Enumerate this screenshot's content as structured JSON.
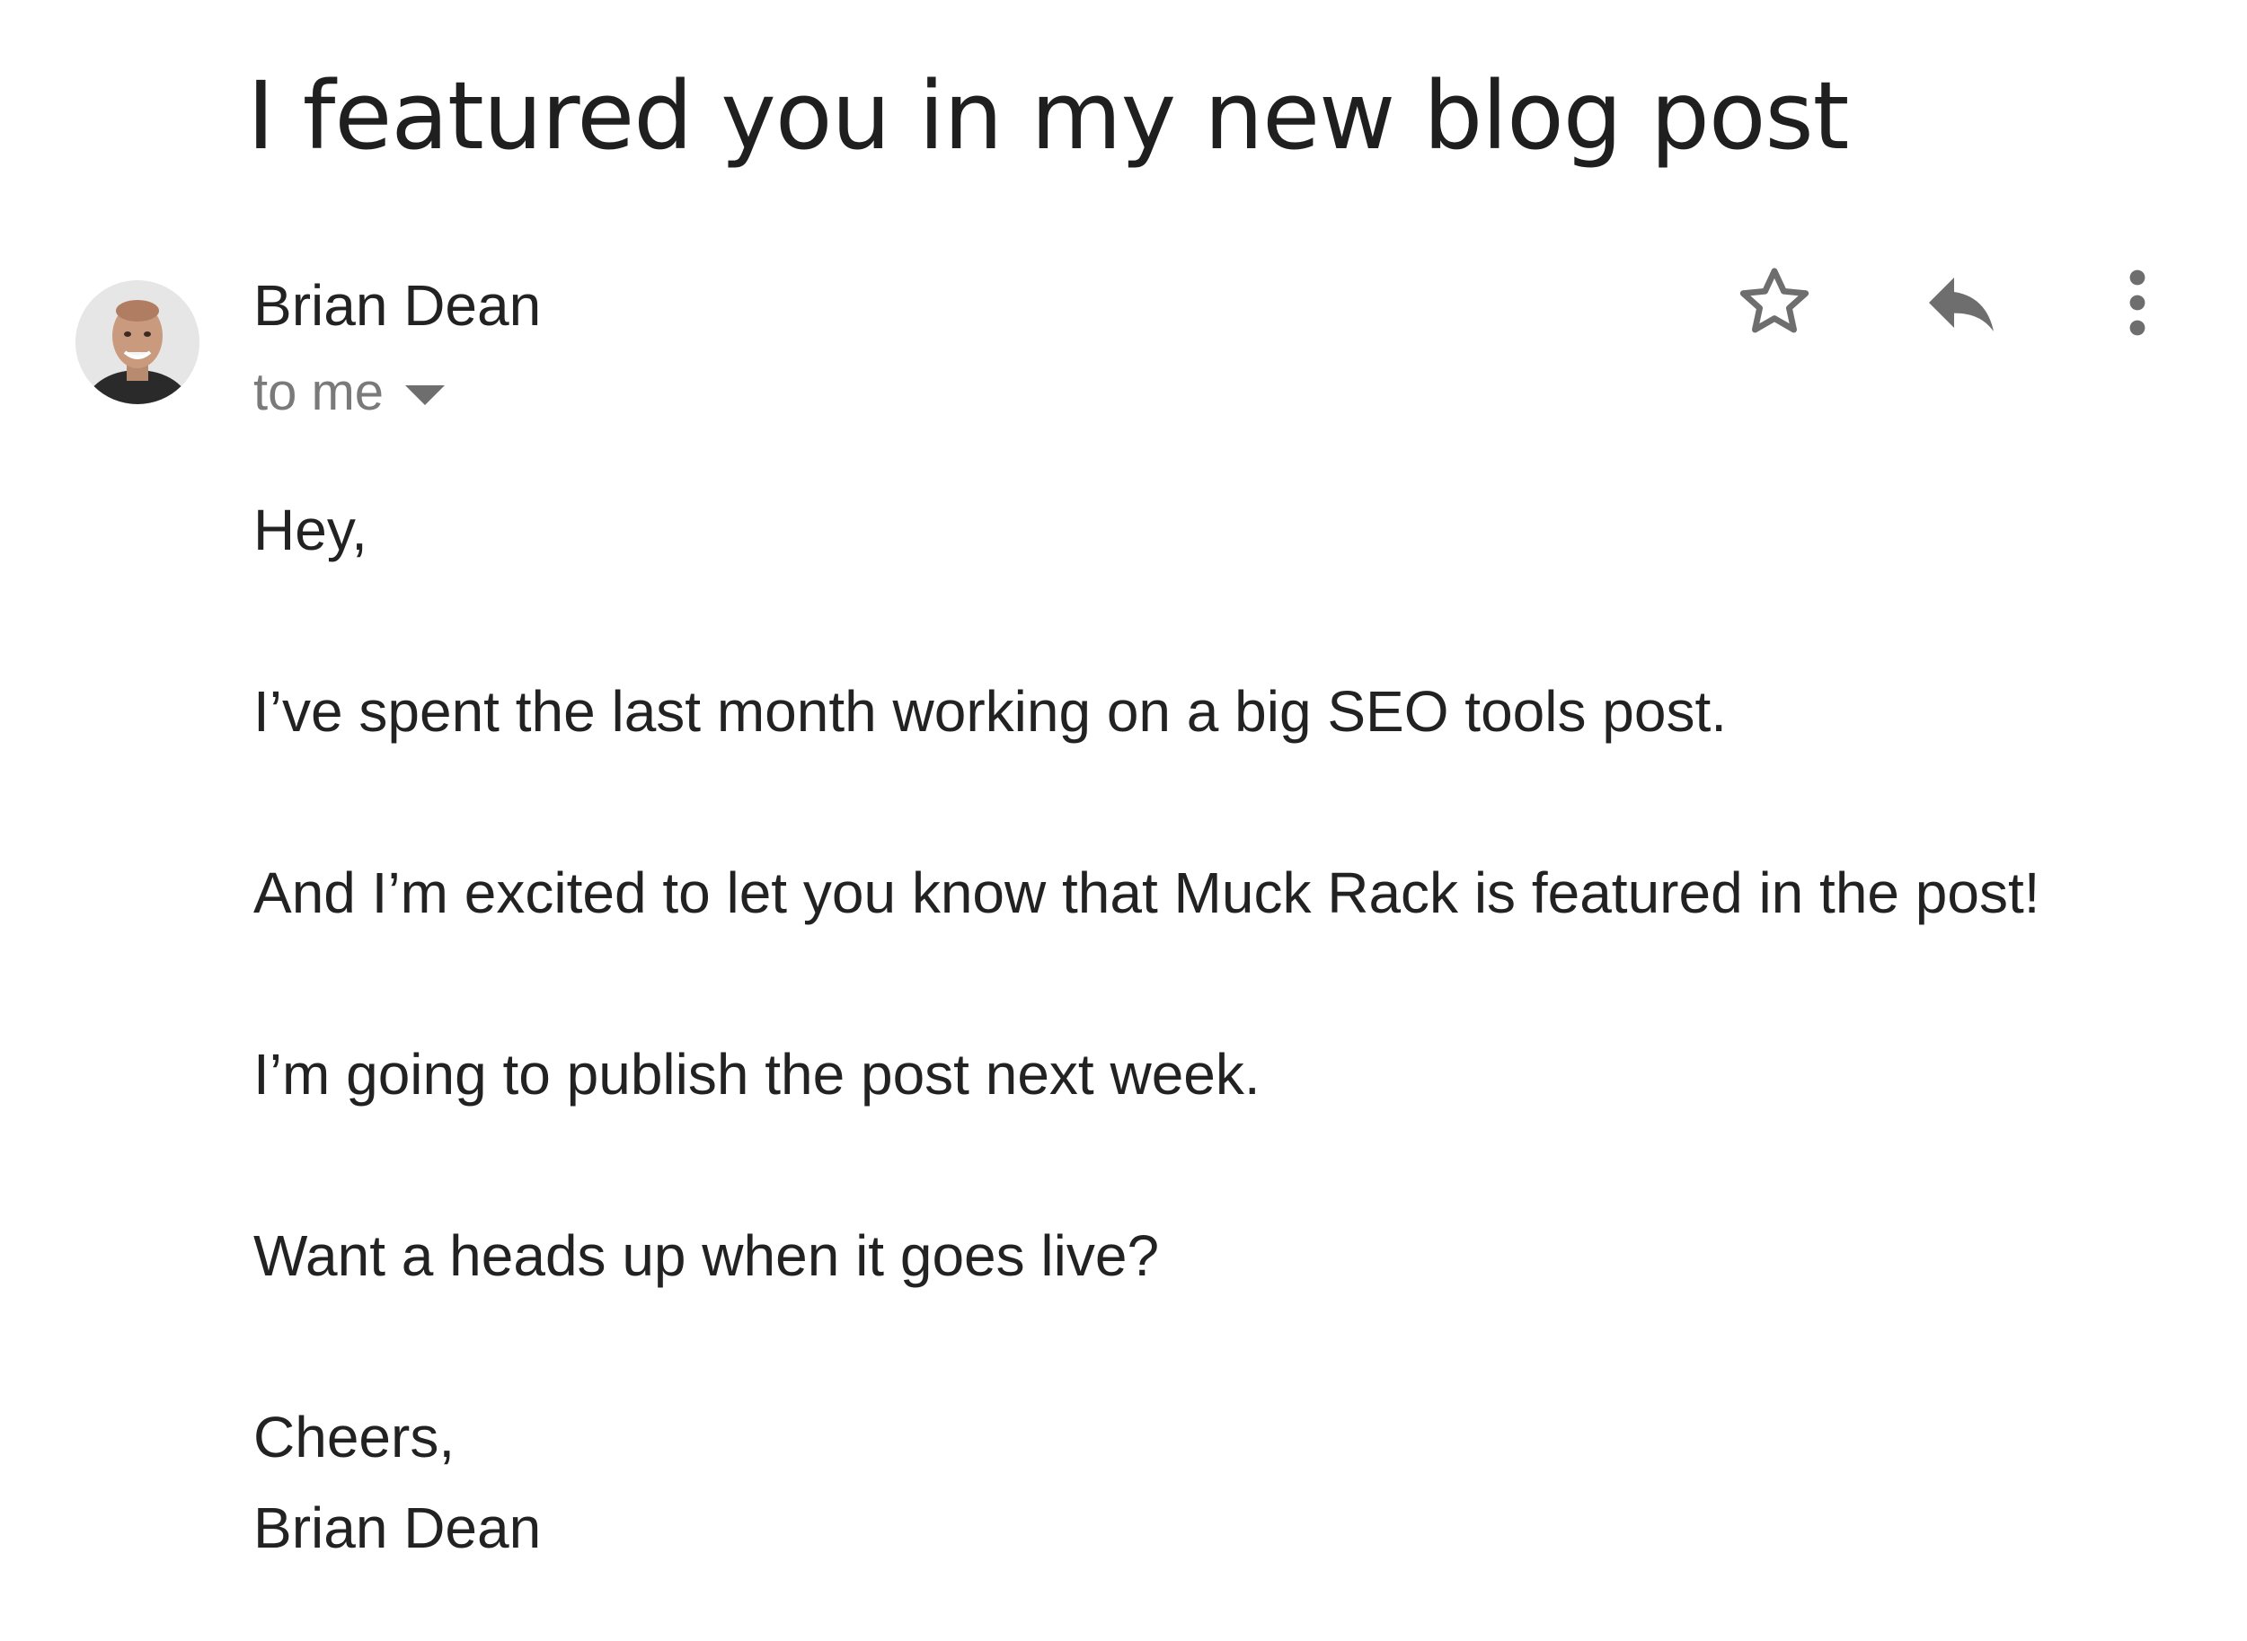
{
  "email": {
    "subject": "I featured you in my new blog post",
    "sender": {
      "name": "Brian Dean",
      "avatar": "avatar-photo"
    },
    "recipient": {
      "label": "to me",
      "icon": "caret-down-icon"
    },
    "actions": [
      {
        "name": "star",
        "icon": "star-icon"
      },
      {
        "name": "reply",
        "icon": "reply-icon"
      },
      {
        "name": "more",
        "icon": "more-vert-icon"
      }
    ],
    "body": {
      "greeting": "Hey,",
      "paragraphs": [
        "I’ve spent the last month working on a big SEO tools post.",
        "And I’m excited to let you know that Muck Rack is featured in the post!",
        "I’m going to publish the post next week.",
        "Want a heads up when it goes live?"
      ],
      "signoff": "Cheers,",
      "signature": "Brian Dean"
    }
  },
  "colors": {
    "text": "#222222",
    "muted": "#7a7a7a",
    "icon": "#6e6e6e",
    "background": "#ffffff"
  }
}
